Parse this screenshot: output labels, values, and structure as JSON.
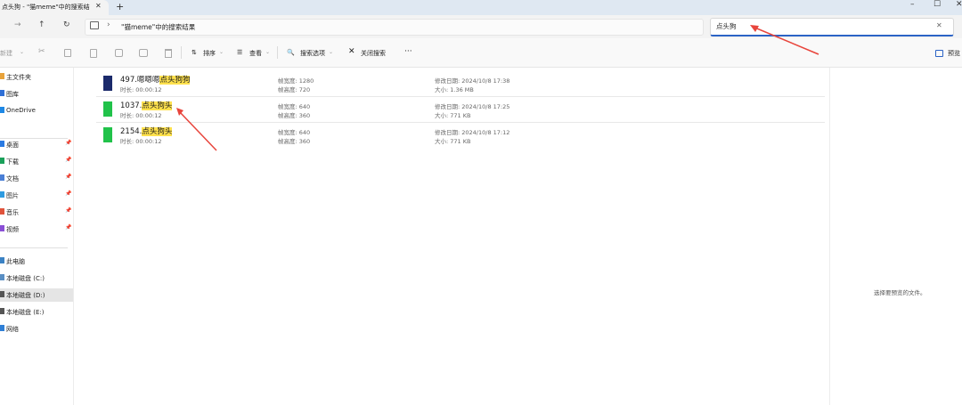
{
  "tab": {
    "title": "点头狗 - \"猫meme\"中的搜索结",
    "close": "✕",
    "new": "+"
  },
  "window": {
    "minimize": "–",
    "maximize": "☐",
    "close": "✕"
  },
  "nav": {
    "back": "←",
    "forward": "→",
    "up": "↑",
    "refresh": "↻",
    "chevron": "›"
  },
  "address": {
    "text": "\"猫meme\"中的搜索结果"
  },
  "search": {
    "value": "点头狗",
    "clear": "✕"
  },
  "toolbar": {
    "new": "新建",
    "sort": "排序",
    "view": "查看",
    "search_options": "搜索选项",
    "close_search": "关闭搜索",
    "more": "···",
    "preview": "预览"
  },
  "sidebar": {
    "items": [
      {
        "label": "主文件夹",
        "color": "#e8a33b"
      },
      {
        "label": "图库",
        "color": "#2f6fd6"
      },
      {
        "label": "OneDrive",
        "color": "#1e88e5"
      },
      {
        "label": "桌面",
        "color": "#2a7ae2",
        "pin": "📌"
      },
      {
        "label": "下载",
        "color": "#1aa05a",
        "pin": "📌"
      },
      {
        "label": "文档",
        "color": "#4a7fd6",
        "pin": "📌"
      },
      {
        "label": "图片",
        "color": "#2e9be0",
        "pin": "📌"
      },
      {
        "label": "音乐",
        "color": "#e0533b",
        "pin": "📌"
      },
      {
        "label": "视频",
        "color": "#8a4fd6",
        "pin": "📌"
      },
      {
        "label": "此电脑",
        "color": "#3b82c4"
      },
      {
        "label": "本地磁盘 (C:)",
        "color": "#5a8fc4"
      },
      {
        "label": "本地磁盘 (D:)",
        "color": "#555555"
      },
      {
        "label": "本地磁盘 (E:)",
        "color": "#555555"
      },
      {
        "label": "网络",
        "color": "#2f7fd6"
      }
    ]
  },
  "labels": {
    "duration": "时长:",
    "frame_width": "帧宽度:",
    "frame_height": "帧高度:",
    "modified": "修改日期:",
    "size": "大小:"
  },
  "files": [
    {
      "prefix": "497.嗯嗯嗯",
      "match": "点头狗狗",
      "duration": "00:00:12",
      "frame_width": "1280",
      "frame_height": "720",
      "modified": "2024/10/8 17:38",
      "size": "1.36 MB",
      "thumb_color": "#1b2a6b"
    },
    {
      "prefix": "1037.",
      "match": "点头狗头",
      "duration": "00:00:12",
      "frame_width": "640",
      "frame_height": "360",
      "modified": "2024/10/8 17:25",
      "size": "771 KB",
      "thumb_color": "#21c24a"
    },
    {
      "prefix": "2154.",
      "match": "点头狗头",
      "duration": "00:00:12",
      "frame_width": "640",
      "frame_height": "360",
      "modified": "2024/10/8 17:12",
      "size": "771 KB",
      "thumb_color": "#21c24a"
    }
  ],
  "preview": {
    "message": "选择要预览的文件。"
  },
  "annotation_color": "#e8453c"
}
